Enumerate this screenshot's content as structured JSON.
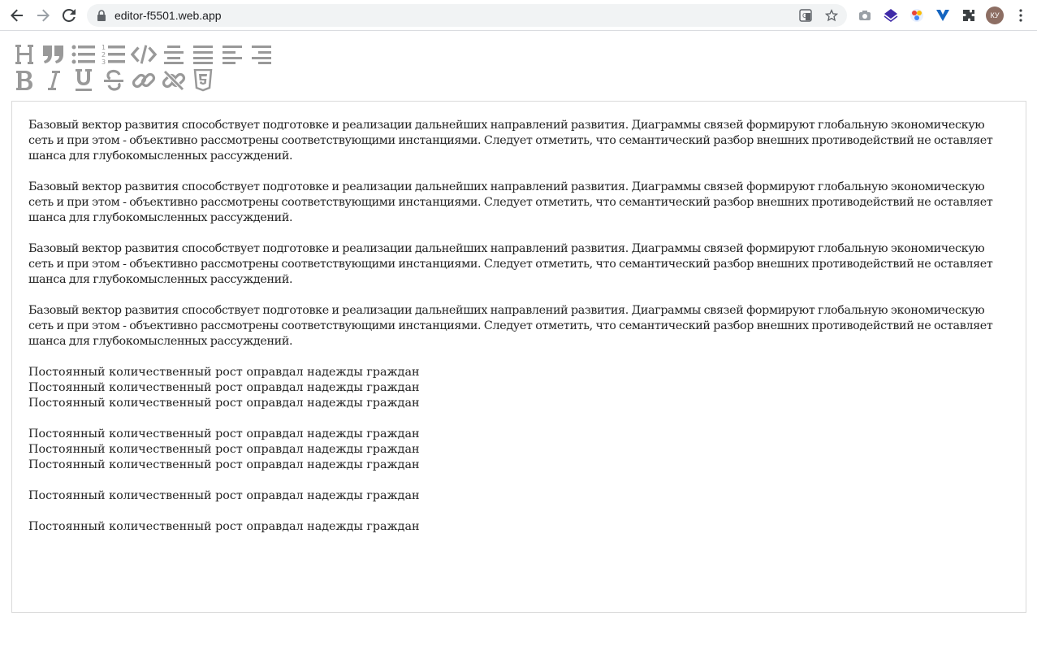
{
  "browser": {
    "url": "editor-f5501.web.app",
    "avatar_initials": "КУ"
  },
  "toolbar": {
    "row1": [
      "heading-icon",
      "quote-icon",
      "bullet-list-icon",
      "numbered-list-icon",
      "code-icon",
      "align-center-icon",
      "align-justify-icon",
      "align-left-icon",
      "align-right-icon"
    ],
    "row2": [
      "bold-icon",
      "italic-icon",
      "underline-icon",
      "strikethrough-icon",
      "link-icon",
      "unlink-icon",
      "html5-icon"
    ],
    "icon_color": "#999999"
  },
  "editor": {
    "paragraphs": [
      "Базовый вектор развития способствует подготовке и реализации дальнейших направлений развития. Диаграммы связей формируют глобальную экономическую сеть и при этом - объективно рассмотрены соответствующими инстанциями. Следует отметить, что семантический разбор внешних противодействий не оставляет шанса для глубокомысленных рассуждений.",
      "Базовый вектор развития способствует подготовке и реализации дальнейших направлений развития. Диаграммы связей формируют глобальную экономическую сеть и при этом - объективно рассмотрены соответствующими инстанциями. Следует отметить, что семантический разбор внешних противодействий не оставляет шанса для глубокомысленных рассуждений.",
      "Базовый вектор развития способствует подготовке и реализации дальнейших направлений развития. Диаграммы связей формируют глобальную экономическую сеть и при этом - объективно рассмотрены соответствующими инстанциями. Следует отметить, что семантический разбор внешних противодействий не оставляет шанса для глубокомысленных рассуждений.",
      "Базовый вектор развития способствует подготовке и реализации дальнейших направлений развития. Диаграммы связей формируют глобальную экономическую сеть и при этом - объективно рассмотрены соответствующими инстанциями. Следует отметить, что семантический разбор внешних противодействий не оставляет шанса для глубокомысленных рассуждений."
    ],
    "line_blocks": [
      [
        "Постоянный количественный рост оправдал надежды граждан",
        "Постоянный количественный рост оправдал надежды граждан",
        "Постоянный количественный рост оправдал надежды граждан"
      ],
      [
        "Постоянный количественный рост оправдал надежды граждан",
        "Постоянный количественный рост оправдал надежды граждан",
        "Постоянный количественный рост оправдал надежды граждан"
      ],
      [
        "Постоянный количественный рост оправдал надежды граждан"
      ],
      [
        "Постоянный количественный рост оправдал надежды граждан"
      ]
    ]
  }
}
